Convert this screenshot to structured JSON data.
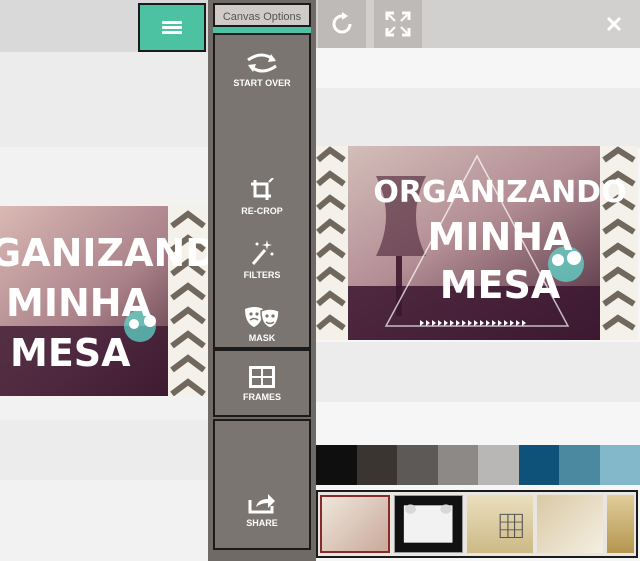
{
  "menu": {
    "title": "Canvas Options",
    "items": [
      {
        "label": "START OVER",
        "icon": "start-over-icon"
      },
      {
        "label": "RE-CROP",
        "icon": "crop-icon"
      },
      {
        "label": "FILTERS",
        "icon": "magic-wand-icon"
      },
      {
        "label": "MASK",
        "icon": "masks-icon"
      },
      {
        "label": "FRAMES",
        "icon": "frames-icon"
      },
      {
        "label": "SHARE",
        "icon": "share-icon"
      }
    ]
  },
  "canvas": {
    "text_lines": [
      "ORGANIZANDO",
      "MINHA",
      "MESA"
    ],
    "left_text_lines": [
      "GANIZANDO",
      "MINHA",
      "MESA"
    ]
  },
  "toolbar": {
    "icons": [
      "rotate-icon",
      "fullscreen-icon",
      "close-icon"
    ]
  },
  "swatches": [
    "#0f0f0f",
    "#3b3532",
    "#5d5957",
    "#8c8987",
    "#b9b7b5",
    "#0f5279",
    "#4b89a1",
    "#82b8c9"
  ],
  "colors": {
    "accent": "#4cc2a2",
    "menu_bg": "#6f6a66"
  }
}
